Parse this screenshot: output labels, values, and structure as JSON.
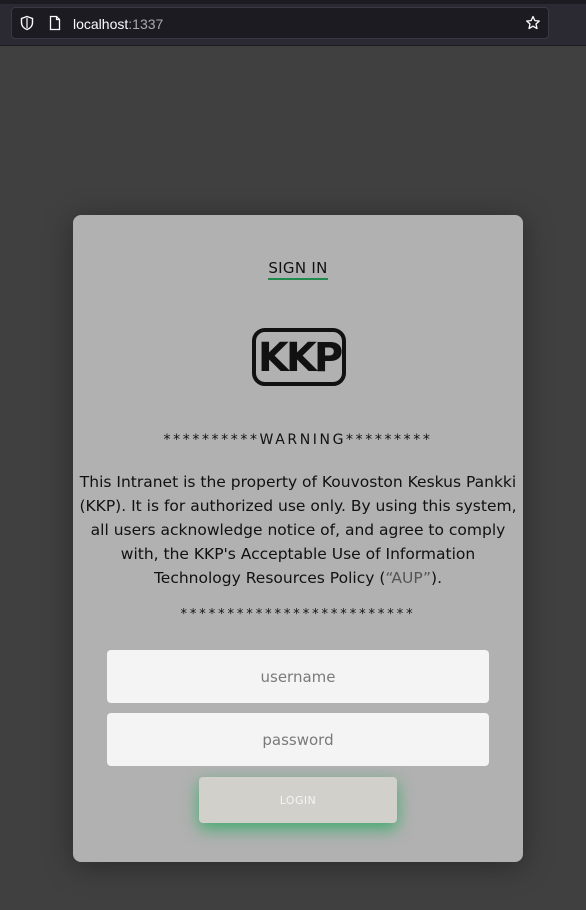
{
  "browser": {
    "url_host": "localhost",
    "url_port": ":1337"
  },
  "login": {
    "title": "SIGN IN",
    "logo_text": "KKP",
    "warning_heading": "**********WARNING*********",
    "policy_text_before": "This Intranet is the property of Kouvoston Keskus Pankki (KKP). It is for authorized use only. By using this system, all users acknowledge notice of, and agree to comply with, the KKP's Acceptable Use of Information Technology Resources Policy (",
    "policy_aup": "“AUP”",
    "policy_text_after": ").",
    "stars_line": "*************************",
    "username_placeholder": "username",
    "password_placeholder": "password",
    "login_label": "LOGIN"
  },
  "colors": {
    "accent": "#1f8a4c",
    "card_bg": "#b1b1b1",
    "page_bg": "#404040"
  }
}
